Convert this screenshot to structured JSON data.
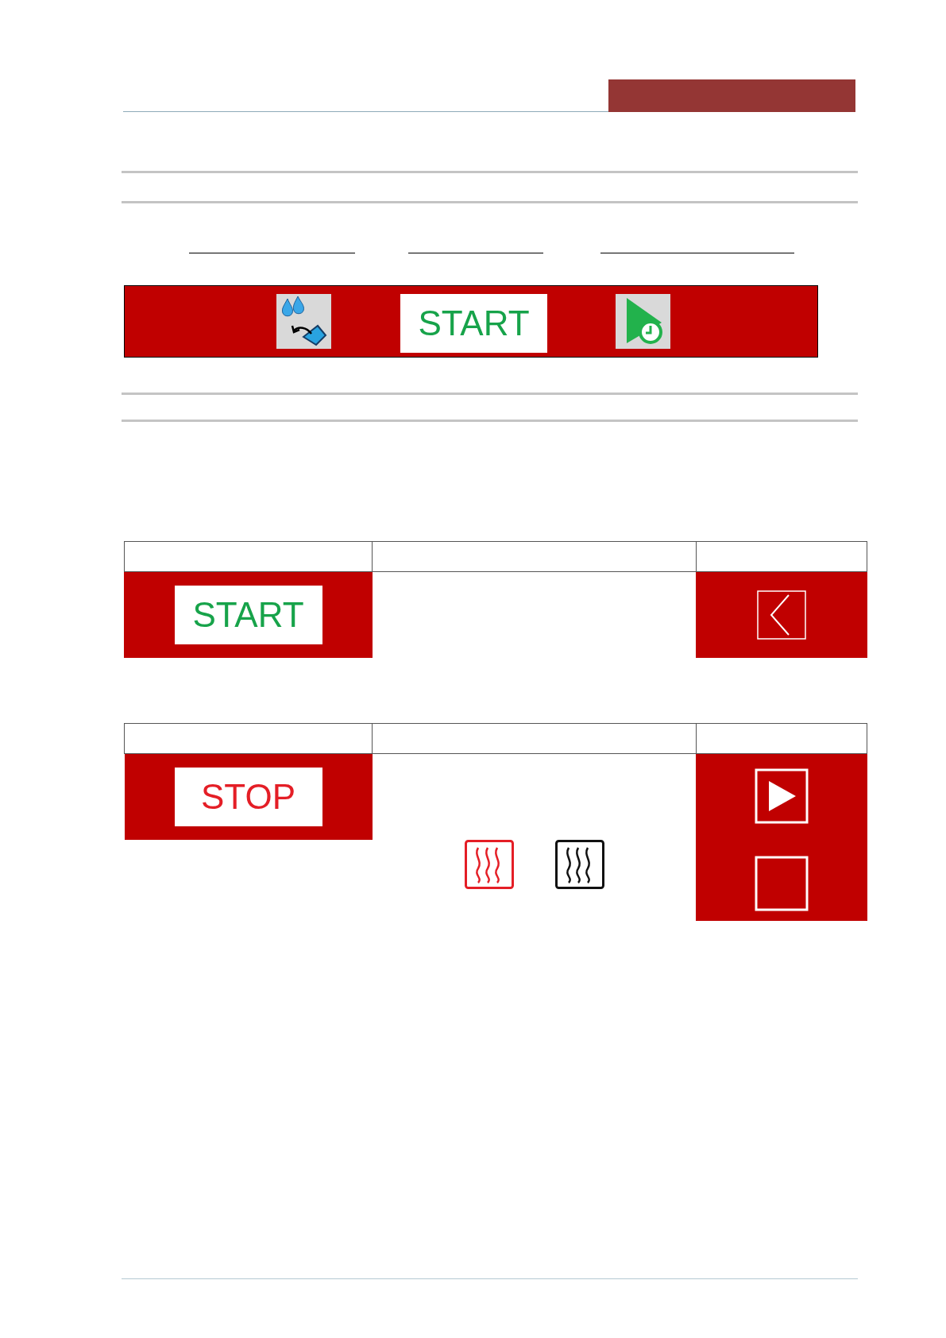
{
  "toolbar": {
    "button": {
      "label": "START",
      "kind": "start"
    }
  },
  "table_1": {
    "button": {
      "label": "START",
      "kind": "start"
    }
  },
  "table_2": {
    "button": {
      "label": "STOP",
      "kind": "stop"
    }
  }
}
